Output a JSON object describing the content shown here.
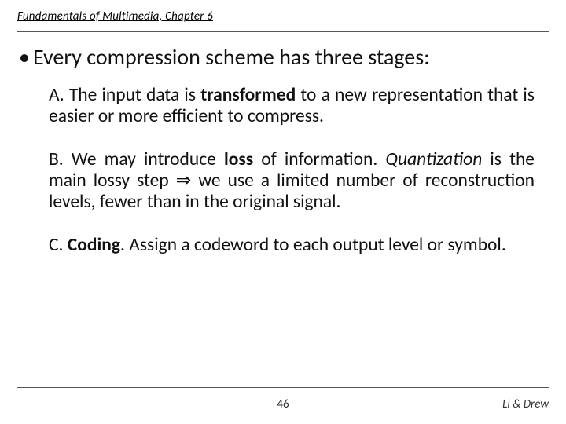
{
  "header": {
    "title": "Fundamentals of Multimedia, Chapter 6"
  },
  "bullet": {
    "marker": "•",
    "text": "Every compression scheme has three stages:"
  },
  "items": {
    "a": {
      "label": "A.",
      "pre": " The input data is ",
      "bold": "transformed",
      "post": " to a new representation that is easier or more efficient to compress."
    },
    "b": {
      "label": "B.",
      "pre": " We may introduce ",
      "bold1": "loss",
      "mid1": " of information. ",
      "ital": "Quantization",
      "mid2": " is the main lossy step ⇒ we use a limited number of reconstruction levels, fewer than in the original signal."
    },
    "c": {
      "label": "C.",
      "pre": " ",
      "bold": "Coding",
      "post": ". Assign a codeword to each output level or symbol."
    }
  },
  "footer": {
    "page": "46",
    "authors": "Li & Drew"
  }
}
